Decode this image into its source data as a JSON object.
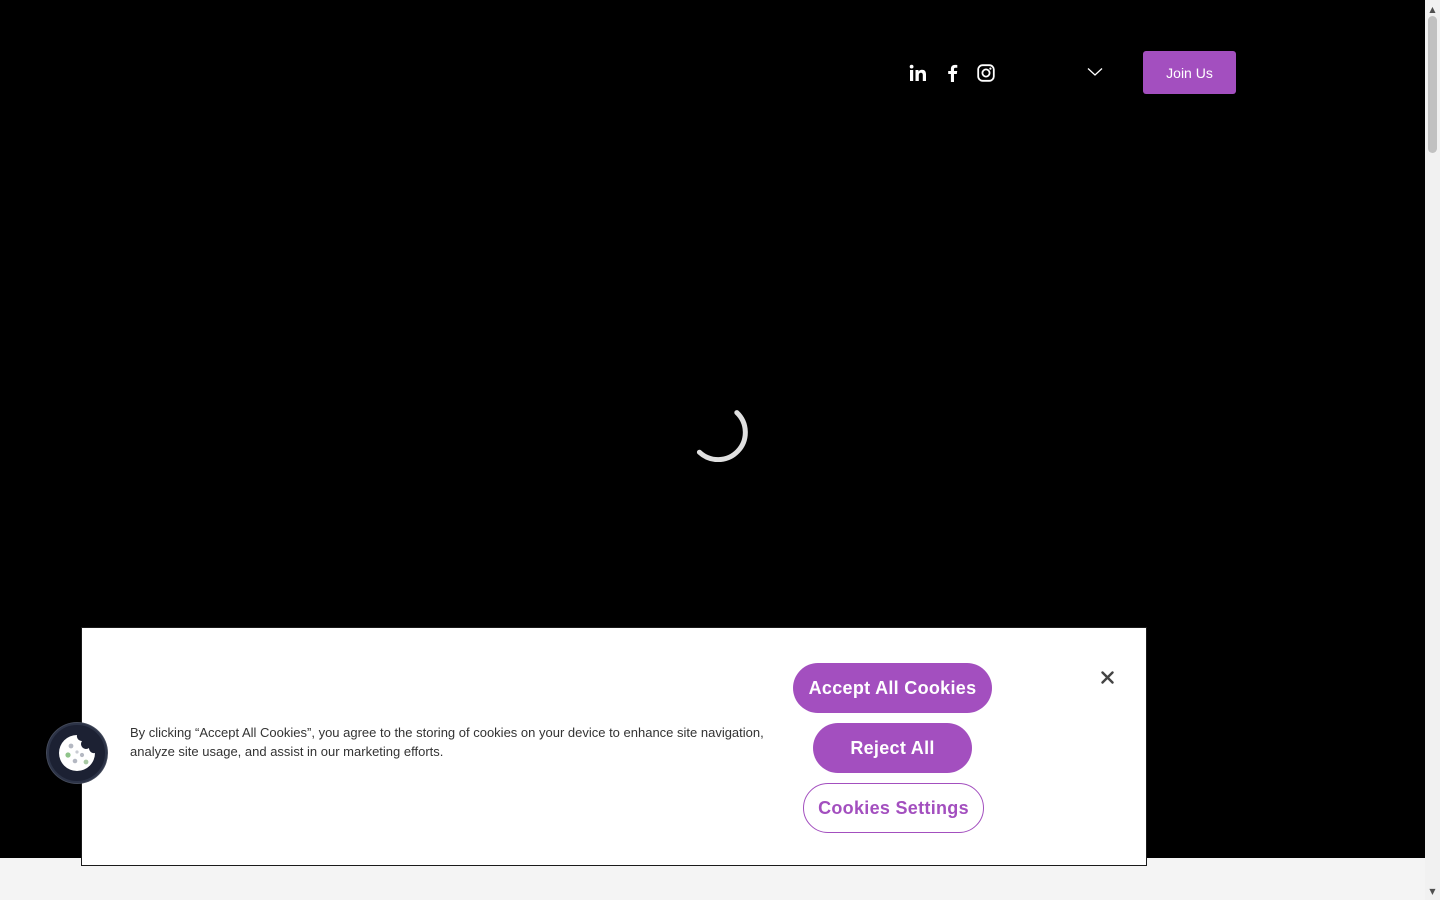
{
  "header": {
    "social": [
      {
        "name": "linkedin-icon",
        "glyph": "in"
      },
      {
        "name": "facebook-icon",
        "glyph": "f"
      },
      {
        "name": "instagram-icon",
        "glyph": "instagram"
      }
    ],
    "language_dropdown": {
      "icon": "chevron-down-icon"
    },
    "join_label": "Join Us"
  },
  "main": {
    "loading": {
      "icon": "loading-spinner-icon"
    }
  },
  "cookie_banner": {
    "text": "By clicking “Accept All Cookies”, you agree to the storing of cookies on your device to enhance site navigation, analyze site usage, and assist in our marketing efforts.",
    "accept_label": "Accept All Cookies",
    "reject_label": "Reject All",
    "settings_label": "Cookies Settings",
    "close_icon": "close-icon",
    "fab_icon": "cookie-icon"
  },
  "colors": {
    "accent": "#a34fbf",
    "background": "#000000",
    "banner_background": "#ffffff",
    "cookie_fab": "#1c2133"
  }
}
